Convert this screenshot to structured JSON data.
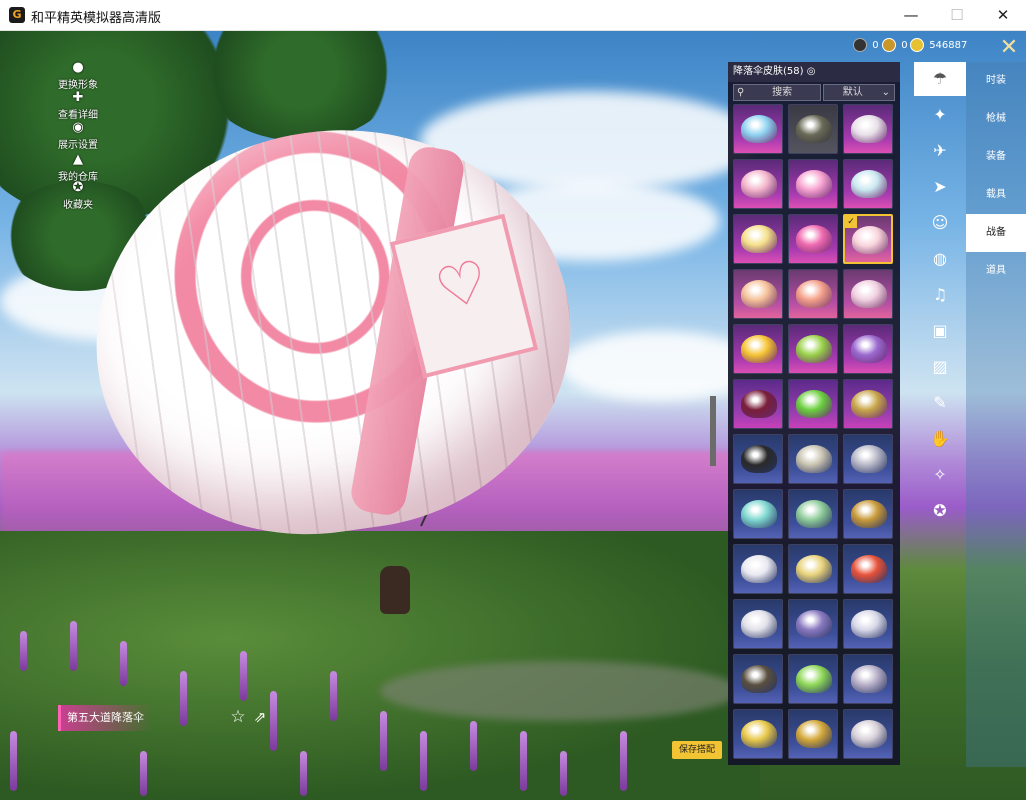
{
  "window": {
    "title": "和平精英模拟器高清版",
    "app_icon": "G",
    "minimize": "—",
    "maximize": "☐",
    "close": "✕"
  },
  "side_menu": [
    {
      "label": "更换形象",
      "icon": "person-icon"
    },
    {
      "label": "查看详细",
      "icon": "puzzle-icon"
    },
    {
      "label": "展示设置",
      "icon": "eye-icon"
    },
    {
      "label": "我的仓库",
      "icon": "hanger-icon"
    },
    {
      "label": "收藏夹",
      "icon": "medal-icon"
    }
  ],
  "currency": {
    "item1_value": "0",
    "item2_value": "0",
    "item3_value": "546887"
  },
  "panel": {
    "title": "降落伞皮肤(58)",
    "search_label": "搜索",
    "sort_label": "默认"
  },
  "grid": {
    "rows": 12,
    "cols": 3,
    "selected_index": 8,
    "cells": [
      {
        "rarity": "pink",
        "color": "#8fd3f0"
      },
      {
        "rarity": "gray",
        "color": "#6a6a58"
      },
      {
        "rarity": "pink",
        "color": "#e8e0e8"
      },
      {
        "rarity": "pink",
        "color": "#f4b6cc"
      },
      {
        "rarity": "pink",
        "color": "#f7a3d0"
      },
      {
        "rarity": "pink",
        "color": "#c9e8f0"
      },
      {
        "rarity": "pink",
        "color": "#f5e08a"
      },
      {
        "rarity": "pink",
        "color": "#f06bb0"
      },
      {
        "rarity": "gold",
        "color": "#f8d4dc"
      },
      {
        "rarity": "gold",
        "color": "#f6c29a"
      },
      {
        "rarity": "gold",
        "color": "#f4a18a"
      },
      {
        "rarity": "gold",
        "color": "#f0d0e0"
      },
      {
        "rarity": "pink",
        "color": "#f6c535"
      },
      {
        "rarity": "pink",
        "color": "#9ad24a"
      },
      {
        "rarity": "pink",
        "color": "#9b6ad0"
      },
      {
        "rarity": "purple",
        "color": "#7a1f3a"
      },
      {
        "rarity": "purple",
        "color": "#6cd03f"
      },
      {
        "rarity": "purple",
        "color": "#c9a74a"
      },
      {
        "rarity": "blue",
        "color": "#2a2a2a"
      },
      {
        "rarity": "blue",
        "color": "#c8c2b0"
      },
      {
        "rarity": "blue",
        "color": "#b8b8c8"
      },
      {
        "rarity": "blue",
        "color": "#7fd8d0"
      },
      {
        "rarity": "blue",
        "color": "#8fcc9a"
      },
      {
        "rarity": "blue",
        "color": "#c99a3a"
      },
      {
        "rarity": "blue",
        "color": "#e8e8f0"
      },
      {
        "rarity": "blue",
        "color": "#e8d27a"
      },
      {
        "rarity": "blue",
        "color": "#e8533a"
      },
      {
        "rarity": "blue",
        "color": "#e0e0e8"
      },
      {
        "rarity": "blue",
        "color": "#8a7ac0"
      },
      {
        "rarity": "blue",
        "color": "#d8d8e8"
      },
      {
        "rarity": "blue",
        "color": "#5a5040"
      },
      {
        "rarity": "blue",
        "color": "#8fd858"
      },
      {
        "rarity": "blue",
        "color": "#b8b0c8"
      },
      {
        "rarity": "blue",
        "color": "#e8c84a"
      },
      {
        "rarity": "blue",
        "color": "#d4a83a"
      },
      {
        "rarity": "blue",
        "color": "#d8d0d8"
      }
    ]
  },
  "category_icons": [
    "parachute-icon",
    "pet-icon",
    "plane-icon",
    "vehicle-icon",
    "emote-icon",
    "grenade-icon",
    "voice-icon",
    "box-icon",
    "picture-icon",
    "spray-icon",
    "hand-icon",
    "wand-icon",
    "star-icon"
  ],
  "tabs": [
    "时装",
    "枪械",
    "装备",
    "载具",
    "战备",
    "道具"
  ],
  "active_tab": 4,
  "item_name": "第五大道降落伞",
  "save_button_label": "保存搭配"
}
